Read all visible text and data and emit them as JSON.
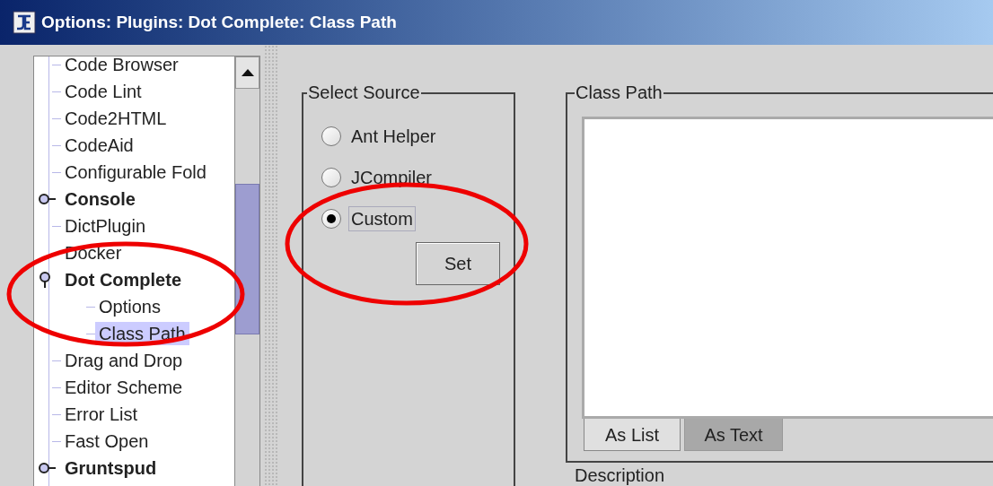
{
  "window": {
    "title": "Options: Plugins: Dot Complete: Class Path"
  },
  "tree": {
    "items": [
      {
        "label": "Code Browser",
        "kind": "leaf",
        "selected": false
      },
      {
        "label": "Code Lint",
        "kind": "leaf",
        "selected": false
      },
      {
        "label": "Code2HTML",
        "kind": "leaf",
        "selected": false
      },
      {
        "label": "CodeAid",
        "kind": "leaf",
        "selected": false
      },
      {
        "label": "Configurable Fold",
        "kind": "leaf",
        "selected": false
      },
      {
        "label": "Console",
        "kind": "folder",
        "expanded": false,
        "selected": false
      },
      {
        "label": "DictPlugin",
        "kind": "leaf",
        "selected": false
      },
      {
        "label": "Docker",
        "kind": "leaf",
        "selected": false
      },
      {
        "label": "Dot Complete",
        "kind": "folder",
        "expanded": true,
        "selected": false,
        "children": [
          {
            "label": "Options",
            "kind": "leaf",
            "selected": false
          },
          {
            "label": "Class Path",
            "kind": "leaf",
            "selected": true
          }
        ]
      },
      {
        "label": "Drag and Drop",
        "kind": "leaf",
        "selected": false
      },
      {
        "label": "Editor Scheme",
        "kind": "leaf",
        "selected": false
      },
      {
        "label": "Error List",
        "kind": "leaf",
        "selected": false
      },
      {
        "label": "Fast Open",
        "kind": "leaf",
        "selected": false
      },
      {
        "label": "Gruntspud",
        "kind": "folder",
        "expanded": false,
        "selected": false
      }
    ]
  },
  "select_source": {
    "title": "Select Source",
    "options": [
      {
        "label": "Ant Helper",
        "selected": false
      },
      {
        "label": "JCompiler",
        "selected": false
      },
      {
        "label": "Custom",
        "selected": true
      }
    ],
    "set_button": "Set"
  },
  "class_path": {
    "title": "Class Path",
    "tabs": [
      {
        "label": "As List",
        "selected": true
      },
      {
        "label": "As Text",
        "selected": false
      }
    ]
  },
  "description": {
    "title": "Description"
  },
  "annotations": [
    {
      "kind": "ellipse"
    },
    {
      "kind": "ellipse"
    }
  ]
}
